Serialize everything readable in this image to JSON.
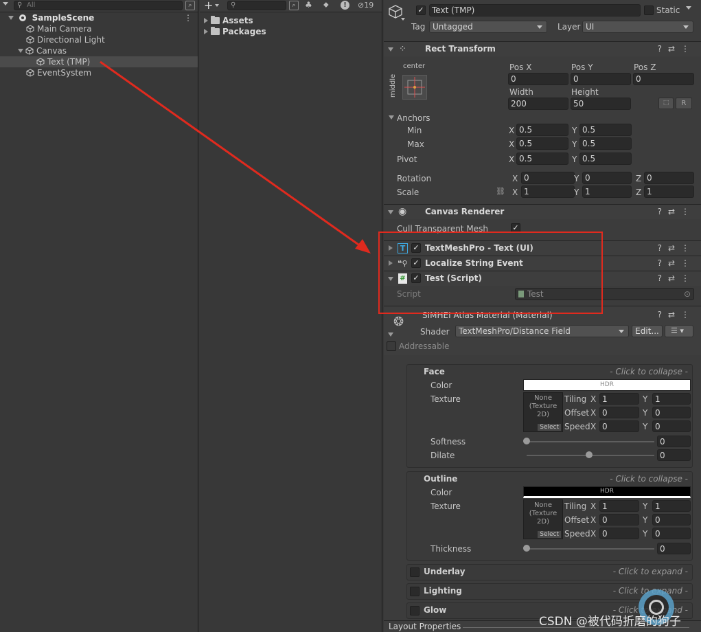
{
  "hierarchy": {
    "search_placeholder": "All",
    "scene": "SampleScene",
    "items": [
      {
        "label": "Main Camera"
      },
      {
        "label": "Directional Light"
      },
      {
        "label": "Canvas"
      },
      {
        "label": "Text (TMP)"
      },
      {
        "label": "EventSystem"
      }
    ]
  },
  "project": {
    "add_label": "+",
    "hidden_count": "19",
    "folders": [
      {
        "label": "Assets"
      },
      {
        "label": "Packages"
      }
    ]
  },
  "inspector": {
    "object_name": "Text (TMP)",
    "static_label": "Static",
    "tag_label": "Tag",
    "tag_value": "Untagged",
    "layer_label": "Layer",
    "layer_value": "UI",
    "rect_transform": {
      "title": "Rect Transform",
      "anchor_h": "center",
      "anchor_v": "middle",
      "pos_x_label": "Pos X",
      "pos_x": "0",
      "pos_y_label": "Pos Y",
      "pos_y": "0",
      "pos_z_label": "Pos Z",
      "pos_z": "0",
      "width_label": "Width",
      "width": "200",
      "height_label": "Height",
      "height": "50",
      "r_label": "R",
      "anchors_label": "Anchors",
      "min_label": "Min",
      "min_x": "0.5",
      "min_y": "0.5",
      "max_label": "Max",
      "max_x": "0.5",
      "max_y": "0.5",
      "pivot_label": "Pivot",
      "pivot_x": "0.5",
      "pivot_y": "0.5",
      "rotation_label": "Rotation",
      "rot_x": "0",
      "rot_y": "0",
      "rot_z": "0",
      "scale_label": "Scale",
      "scale_x": "1",
      "scale_y": "1",
      "scale_z": "1",
      "x": "X",
      "y": "Y",
      "z": "Z"
    },
    "canvas_renderer": {
      "title": "Canvas Renderer",
      "cull_label": "Cull Transparent Mesh"
    },
    "textmeshpro": {
      "title": "TextMeshPro - Text (UI)"
    },
    "localize": {
      "title": "Localize String Event"
    },
    "test_script": {
      "title": "Test (Script)",
      "script_label": "Script",
      "script_value": "Test"
    },
    "material": {
      "title": "SIMHEI Atlas Material (Material)",
      "shader_label": "Shader",
      "shader_value": "TextMeshPro/Distance Field",
      "edit_label": "Edit...",
      "addressable_label": "Addressable"
    },
    "face": {
      "title": "Face",
      "hint": "- Click to collapse -",
      "color_label": "Color",
      "hdr": "HDR",
      "texture_label": "Texture",
      "tex_none": "None (Texture 2D)",
      "tex_select": "Select",
      "tiling_label": "Tiling",
      "tiling_x": "1",
      "tiling_y": "1",
      "offset_label": "Offset",
      "offset_x": "0",
      "offset_y": "0",
      "speed_label": "Speed",
      "speed_x": "0",
      "speed_y": "0",
      "softness_label": "Softness",
      "softness": "0",
      "softness_level": 0.0,
      "dilate_label": "Dilate",
      "dilate": "0",
      "dilate_level": 0.5
    },
    "outline": {
      "title": "Outline",
      "hint": "- Click to collapse -",
      "color_label": "Color",
      "hdr": "HDR",
      "texture_label": "Texture",
      "tex_none": "None (Texture 2D)",
      "tex_select": "Select",
      "tiling_label": "Tiling",
      "tiling_x": "1",
      "tiling_y": "1",
      "offset_label": "Offset",
      "offset_x": "0",
      "offset_y": "0",
      "speed_label": "Speed",
      "speed_x": "0",
      "speed_y": "0",
      "thickness_label": "Thickness",
      "thickness": "0",
      "thickness_level": 0.0
    },
    "underlay": {
      "title": "Underlay",
      "hint": "- Click to expand -"
    },
    "lighting": {
      "title": "Lighting",
      "hint": "- Click to expand -"
    },
    "glow": {
      "title": "Glow",
      "hint": "- Click to expand -"
    },
    "layout_props": "Layout Properties"
  },
  "watermark": "CSDN @被代码折磨的狗子"
}
